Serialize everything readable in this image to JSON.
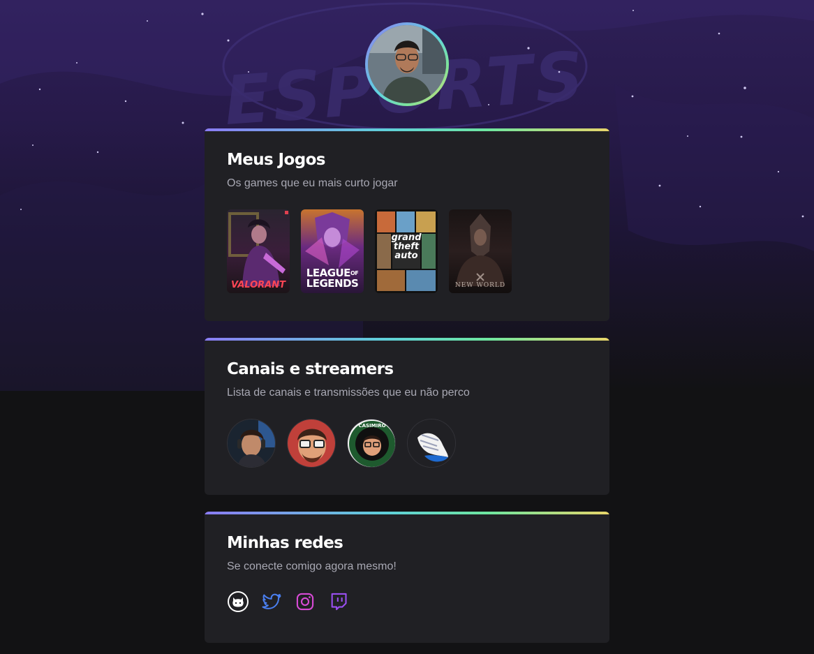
{
  "profile": {
    "avatar_alt": "profile-photo"
  },
  "background": {
    "brand_text": "ESPORTS"
  },
  "games_card": {
    "title": "Meus Jogos",
    "subtitle": "Os games que eu mais curto jogar",
    "games": [
      {
        "name": "VALORANT",
        "icon": "valorant-cover"
      },
      {
        "name": "LEAGUE OF LEGENDS",
        "line1": "LEAGUE",
        "of": "OF",
        "line2": "LEGENDS",
        "icon": "lol-cover"
      },
      {
        "name": "Grand Theft Auto V",
        "line1": "grand",
        "line2": "theft",
        "line3": "auto",
        "icon": "gta-cover"
      },
      {
        "name": "NEW WORLD",
        "icon": "new-world-cover"
      }
    ]
  },
  "streamers_card": {
    "title": "Canais e streamers",
    "subtitle": "Lista de canais e transmissões que eu não perco",
    "streamers": [
      {
        "icon": "streamer-1-avatar"
      },
      {
        "icon": "streamer-2-avatar"
      },
      {
        "badge": "CASIMIRO",
        "icon": "casimiro-avatar"
      },
      {
        "icon": "winged-logo-avatar"
      }
    ]
  },
  "socials_card": {
    "title": "Minhas redes",
    "subtitle": "Se conecte comigo agora mesmo!",
    "links": [
      {
        "icon": "github-icon"
      },
      {
        "icon": "twitter-icon"
      },
      {
        "icon": "instagram-icon"
      },
      {
        "icon": "twitch-icon"
      }
    ]
  },
  "colors": {
    "background": "#121214",
    "card": "#202024",
    "title": "#ffffff",
    "subtitle": "#a8a8b3",
    "twitter": "#4a7ff0",
    "instagram": "#d84ad6",
    "twitch": "#9a4ff0"
  }
}
